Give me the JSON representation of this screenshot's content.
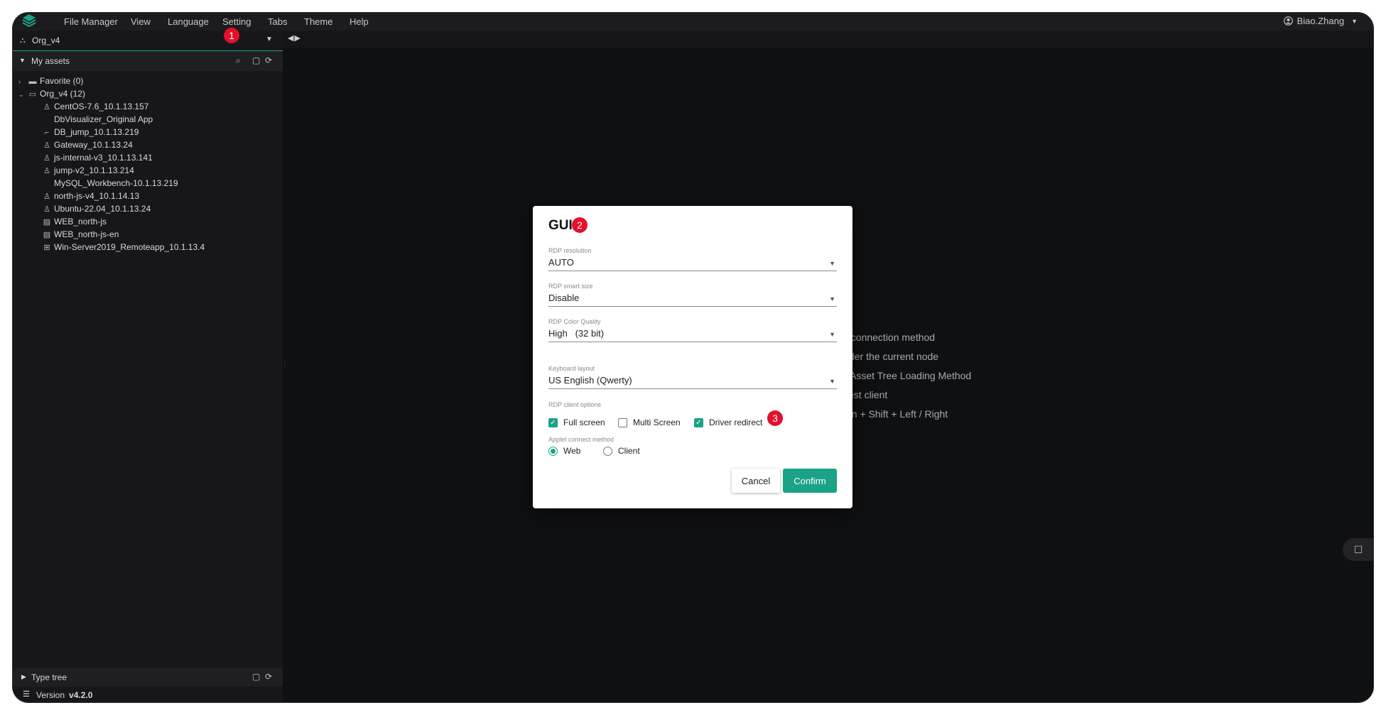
{
  "menubar": {
    "items": [
      "File Manager",
      "View",
      "Language",
      "Setting",
      "Tabs",
      "Theme",
      "Help"
    ],
    "user": "Biao.Zhang"
  },
  "sidebar": {
    "org": "Org_v4",
    "assets_header": "My assets",
    "tree": [
      {
        "label": "Favorite (0)",
        "icon": "folder-icon",
        "expand": "collapsed"
      },
      {
        "label": "Org_v4 (12)",
        "icon": "folder-open-icon",
        "expand": "expanded"
      },
      {
        "label": "CentOS-7.6_10.1.13.157",
        "icon": "linux-icon"
      },
      {
        "label": "DbVisualizer_Original App",
        "icon": ""
      },
      {
        "label": "DB_jump_10.1.13.219",
        "icon": "database-icon"
      },
      {
        "label": "Gateway_10.1.13.24",
        "icon": "linux-icon"
      },
      {
        "label": "js-internal-v3_10.1.13.141",
        "icon": "linux-icon"
      },
      {
        "label": "jump-v2_10.1.13.214",
        "icon": "linux-icon"
      },
      {
        "label": "MySQL_Workbench-10.1.13.219",
        "icon": ""
      },
      {
        "label": "north-js-v4_10.1.14.13",
        "icon": "linux-icon"
      },
      {
        "label": "Ubuntu-22.04_10.1.13.24",
        "icon": "linux-icon"
      },
      {
        "label": "WEB_north-js",
        "icon": "web-icon"
      },
      {
        "label": "WEB_north-js-en",
        "icon": "web-icon"
      },
      {
        "label": "Win-Server2019_Remoteapp_10.1.13.4",
        "icon": "windows-icon"
      }
    ],
    "type_tree": "Type tree",
    "version_label": "Version",
    "version_value": "v4.2.0"
  },
  "hints": [
    "t connection method",
    "der the current node",
    "Asset Tree Loading Method",
    "est client",
    "on + Shift + Left / Right"
  ],
  "modal": {
    "title": "GUI",
    "rdp_resolution": {
      "label": "RDP resolution",
      "value": "AUTO"
    },
    "rdp_smart_size": {
      "label": "RDP smart size",
      "value": "Disable"
    },
    "rdp_color_quality": {
      "label": "RDP Color Quality",
      "value": "High   (32 bit)"
    },
    "keyboard_layout": {
      "label": "Keyboard layout",
      "value": "US English (Qwerty)"
    },
    "client_options": {
      "label": "RDP client options",
      "full_screen": "Full screen",
      "multi_screen": "Multi Screen",
      "driver_redirect": "Driver redirect",
      "checked": {
        "full_screen": true,
        "multi_screen": false,
        "driver_redirect": true
      }
    },
    "applet_method": {
      "label": "Applet connect method",
      "web": "Web",
      "client": "Client",
      "selected": "Web"
    },
    "cancel": "Cancel",
    "confirm": "Confirm"
  },
  "badges": [
    "1",
    "2",
    "3"
  ],
  "colors": {
    "accent": "#1aa386",
    "badge": "#e5102b",
    "background": "#0f1012"
  }
}
